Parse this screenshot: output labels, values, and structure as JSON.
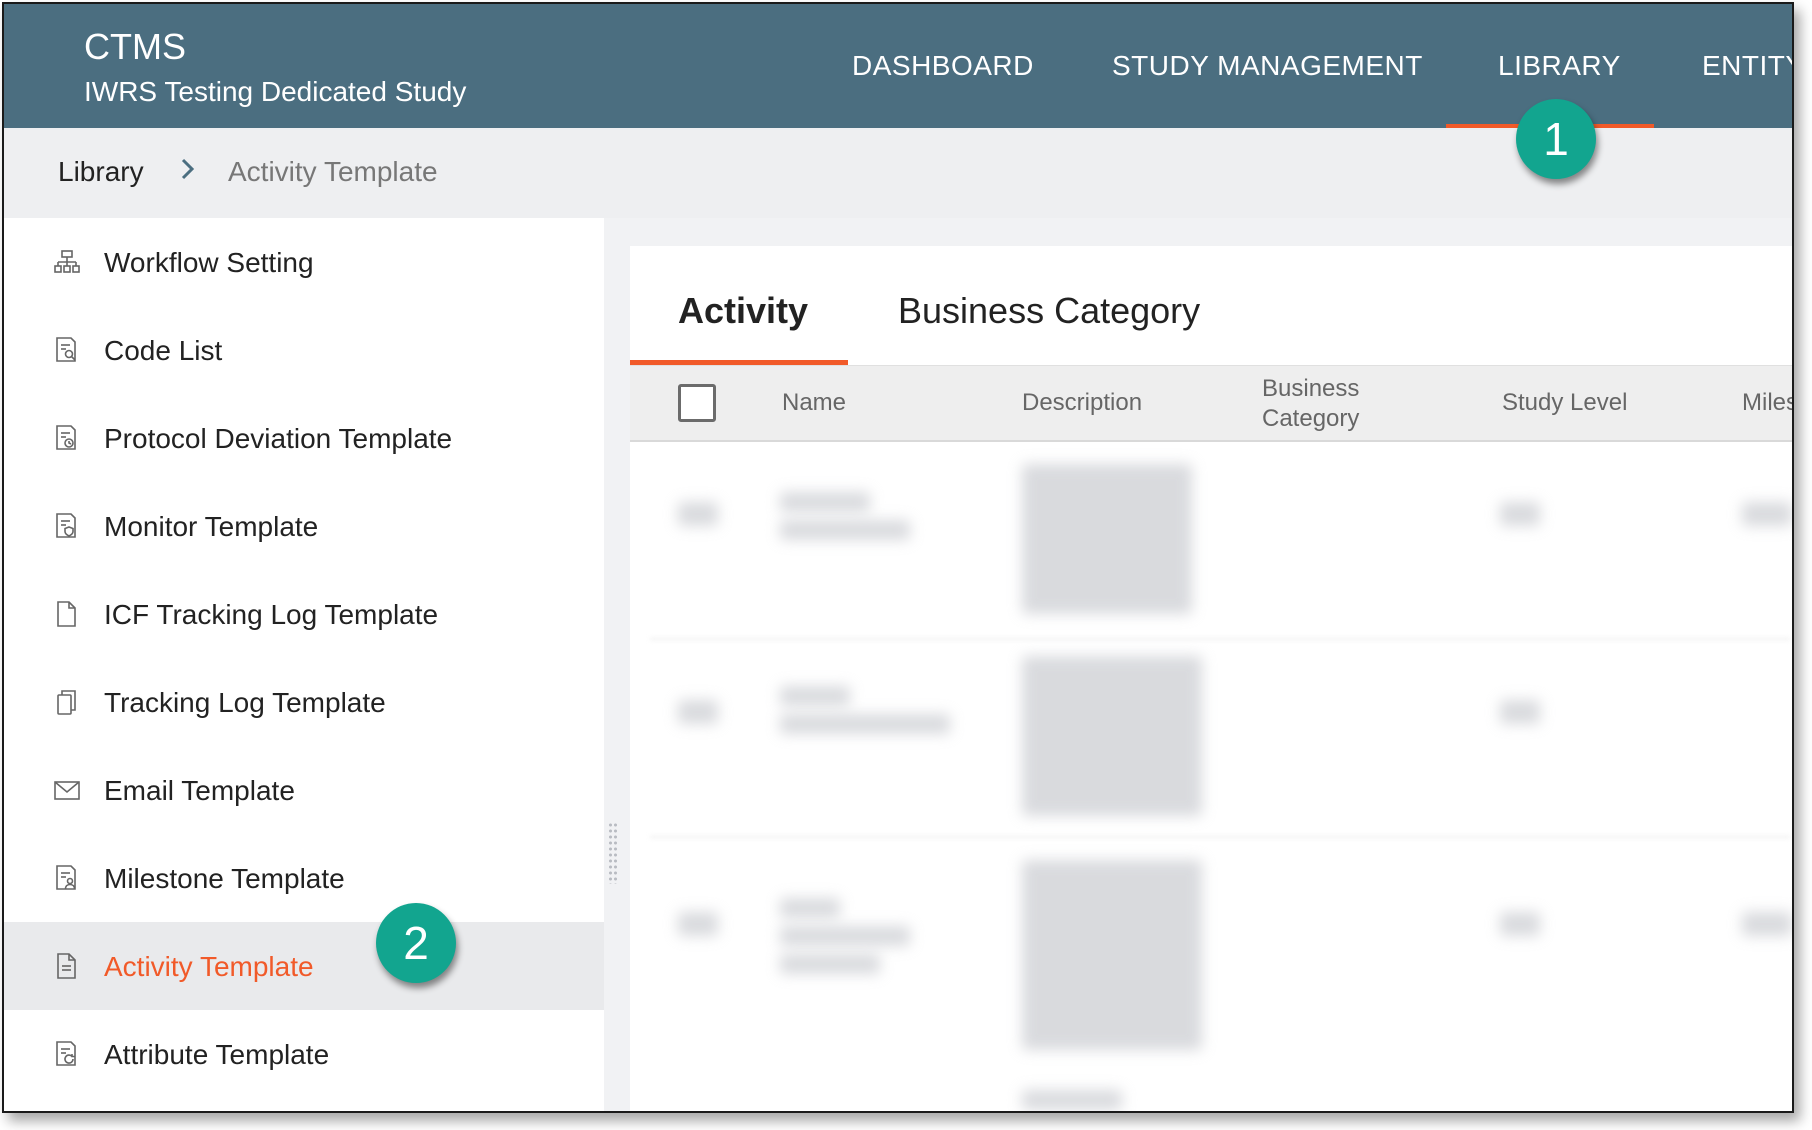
{
  "header": {
    "app_title": "CTMS",
    "study_name": "IWRS Testing Dedicated Study",
    "nav": [
      "DASHBOARD",
      "STUDY MANAGEMENT",
      "LIBRARY",
      "ENTITY"
    ],
    "active_nav": "LIBRARY"
  },
  "breadcrumb": {
    "root": "Library",
    "current": "Activity Template"
  },
  "sidebar": {
    "items": [
      {
        "label": "Workflow Setting",
        "icon": "workflow-icon"
      },
      {
        "label": "Code List",
        "icon": "document-search-icon"
      },
      {
        "label": "Protocol Deviation Template",
        "icon": "document-clock-icon"
      },
      {
        "label": "Monitor Template",
        "icon": "document-shield-icon"
      },
      {
        "label": "ICF Tracking Log Template",
        "icon": "file-icon"
      },
      {
        "label": "Tracking Log Template",
        "icon": "copy-icon"
      },
      {
        "label": "Email Template",
        "icon": "envelope-icon"
      },
      {
        "label": "Milestone Template",
        "icon": "document-person-icon"
      },
      {
        "label": "Activity Template",
        "icon": "document-icon"
      },
      {
        "label": "Attribute Template",
        "icon": "document-refresh-icon"
      }
    ],
    "active": "Activity Template"
  },
  "main": {
    "tabs": [
      "Activity",
      "Business Category"
    ],
    "active_tab": "Activity",
    "columns": [
      "Name",
      "Description",
      "Business",
      "Category",
      "Study Level",
      "Miles"
    ]
  },
  "annotations": {
    "badge_1": "1",
    "badge_2": "2"
  },
  "colors": {
    "header_bg": "#4b6e80",
    "accent": "#f15a29",
    "badge": "#12a58f"
  }
}
